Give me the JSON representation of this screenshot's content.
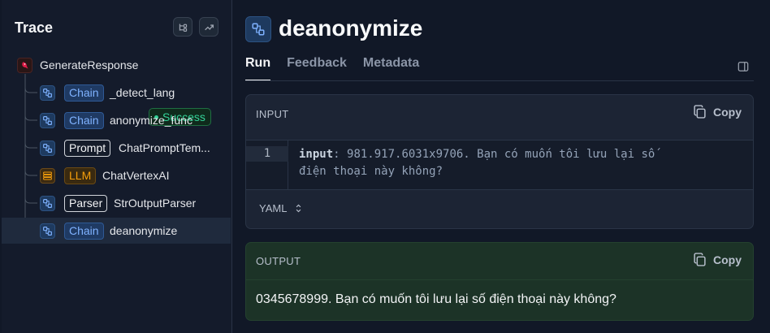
{
  "trace": {
    "title": "Trace",
    "root": {
      "label": "GenerateResponse",
      "status": "Success"
    },
    "children": [
      {
        "tag": "Chain",
        "label": "_detect_lang"
      },
      {
        "tag": "Chain",
        "label": "anonymize_func"
      },
      {
        "tag": "Prompt",
        "label": "ChatPromptTem..."
      },
      {
        "tag": "LLM",
        "label": "ChatVertexAI"
      },
      {
        "tag": "Parser",
        "label": "StrOutputParser"
      },
      {
        "tag": "Chain",
        "label": "deanonymize"
      }
    ]
  },
  "detail": {
    "title": "deanonymize",
    "tabs": [
      "Run",
      "Feedback",
      "Metadata"
    ],
    "active_tab": "Run",
    "input": {
      "header": "INPUT",
      "copy_label": "Copy",
      "line_number": "1",
      "key": "input",
      "value_line1": ": 981.917.6031x9706. Bạn có muốn tôi lưu lại số",
      "value_line2": "điện thoại này không?",
      "format": "YAML"
    },
    "output": {
      "header": "OUTPUT",
      "copy_label": "Copy",
      "text": "0345678999. Bạn có muốn tôi lưu lại số điện thoại này không?"
    }
  },
  "colors": {
    "background": "#111827",
    "chain_accent": "#7fb2ff",
    "llm_accent": "#f59e0b",
    "success": "#34d399",
    "output_bg": "#1c3327"
  }
}
